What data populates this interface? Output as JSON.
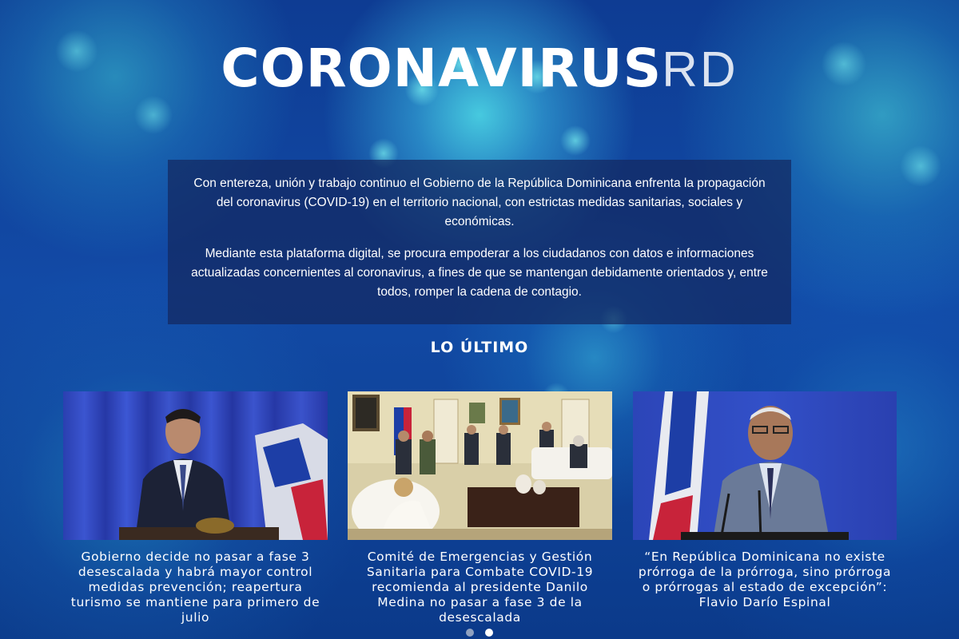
{
  "header": {
    "title_main": "CORONAVIRUS",
    "title_suffix": "RD"
  },
  "intro": {
    "paragraph_1": "Con entereza, unión y trabajo continuo el Gobierno de la República Dominicana enfrenta la propagación del coronavirus (COVID-19) en el territorio nacional, con estrictas medidas sanitarias, sociales y económicas.",
    "paragraph_2": "Mediante esta plataforma digital, se procura empoderar a los ciudadanos con datos e informaciones actualizadas concernientes al coronavirus, a fines de que se mantengan debidamente orientados y, entre todos, romper la cadena de contagio."
  },
  "latest": {
    "heading": "LO ÚLTIMO",
    "items": [
      {
        "caption": "Gobierno decide no pasar a fase 3 desescalada y habrá mayor control medidas prevención; reapertura turismo se mantiene para primero de julio"
      },
      {
        "caption": "Comité de Emergencias y Gestión Sanitaria para Combate COVID-19 recomienda al presidente Danilo Medina no pasar a fase 3 de la desescalada"
      },
      {
        "caption": "“En República Dominicana no existe prórroga de la prórroga, sino prórroga o prórrogas al estado de excepción”: Flavio Darío Espinal"
      }
    ]
  },
  "carousel": {
    "page_count": 2,
    "active_index": 1
  },
  "colors": {
    "background": "#0d3a8c",
    "accent_cyan": "#50e1eb",
    "intro_box": "#14285f",
    "text": "#ffffff"
  }
}
